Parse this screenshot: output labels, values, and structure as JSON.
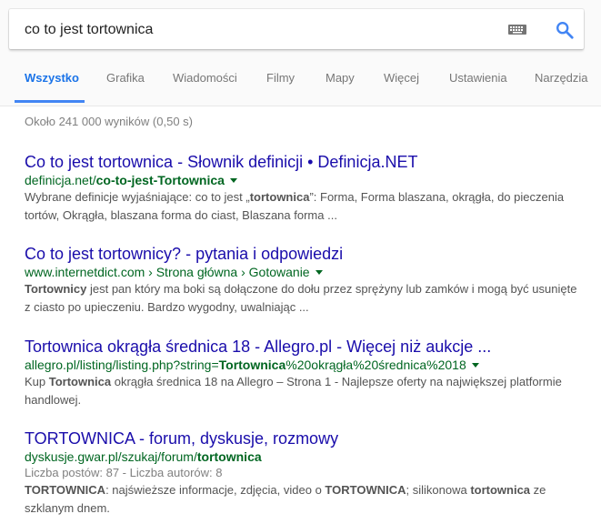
{
  "search": {
    "query": "co to jest tortownica"
  },
  "tabs": [
    {
      "label": "Wszystko",
      "active": true
    },
    {
      "label": "Grafika"
    },
    {
      "label": "Wiadomości"
    },
    {
      "label": "Filmy"
    },
    {
      "label": "Mapy"
    },
    {
      "label": "Więcej"
    },
    {
      "label": "Ustawienia"
    },
    {
      "label": "Narzędzia"
    }
  ],
  "stats": "Około 241 000 wyników (0,50 s)",
  "results": [
    {
      "title": "Co to jest tortownica - Słownik definicji • Definicja.NET",
      "url_plain": "definicja.net/",
      "url_bold": "co-to-jest-Tortownica",
      "url_tail": "",
      "snippet_html": "Wybrane definicje wyjaśniające: co to jest „<b>tortownica</b>”: Forma, Forma blaszana, okrągła, do pieczenia tortów, Okrągła, blaszana forma do ciast, Blaszana forma ..."
    },
    {
      "title": "Co to jest tortownicy? - pytania i odpowiedzi",
      "url_plain": "www.internetdict.com › Strona główna › Gotowanie",
      "url_bold": "",
      "url_tail": "",
      "snippet_html": "<b>Tortownicy</b> jest pan który ma boki są dołączone do dołu przez sprężyny lub zamków i mogą być usunięte z ciasto po upieczeniu. Bardzo wygodny, uwalniając ..."
    },
    {
      "title": "Tortownica okrągła średnica 18 - Allegro.pl - Więcej niż aukcje ...",
      "url_plain": "allegro.pl/listing/listing.php?string=",
      "url_bold": "Tortownica",
      "url_tail": "%20okrągła%20średnica%2018",
      "snippet_html": "Kup <b>Tortownica</b> okrągła średnica 18 na Allegro – Strona 1 - Najlepsze oferty na największej platformie handlowej."
    },
    {
      "title": "TORTOWNICA - forum, dyskusje, rozmowy",
      "url_plain": "dyskusje.gwar.pl/szukaj/forum/",
      "url_bold": "tortownica",
      "url_tail": "",
      "meta": "Liczba postów: 87 - Liczba autorów: 8",
      "snippet_html": "<b>TORTOWNICA</b>: najświeższe informacje, zdjęcia, video o <b>TORTOWNICA</b>; silikonowa <b>tortownica</b> ze szklanym dnem."
    }
  ]
}
